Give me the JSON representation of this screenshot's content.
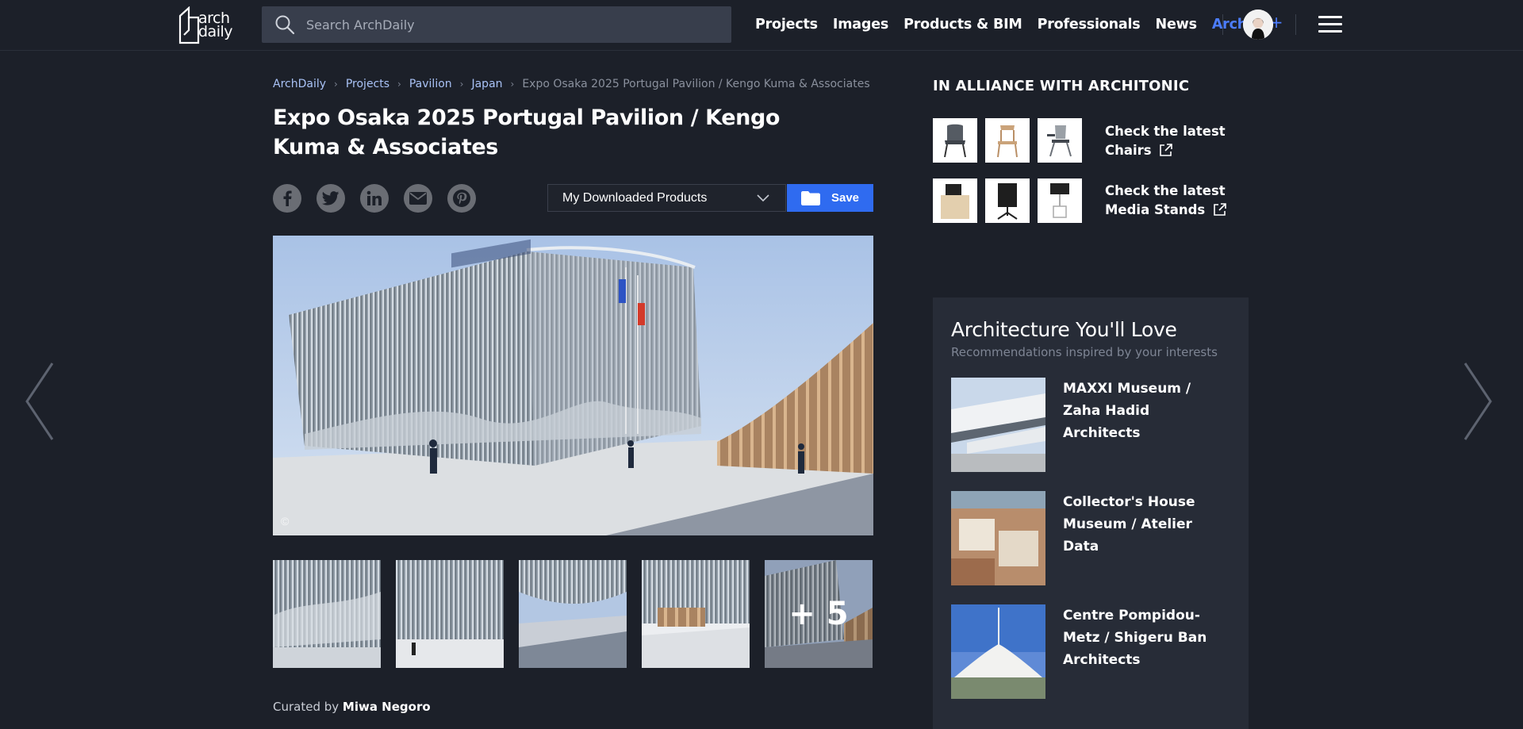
{
  "header": {
    "logo_text": "arch\ndaily",
    "search_placeholder": "Search ArchDaily",
    "nav": [
      "Projects",
      "Images",
      "Products & BIM",
      "Professionals",
      "News"
    ],
    "archive_label": "Archive",
    "archive_suffix": "+"
  },
  "breadcrumb": {
    "items": [
      "ArchDaily",
      "Projects",
      "Pavilion",
      "Japan"
    ],
    "current": "Expo Osaka 2025 Portugal Pavilion / Kengo Kuma & Associates"
  },
  "article": {
    "title": "Expo Osaka 2025 Portugal Pavilion / Kengo Kuma & Associates",
    "dropdown_value": "My Downloaded Products",
    "save_label": "Save",
    "hero_copyright": "©",
    "more_images": "+ 5",
    "curated_prefix": "Curated by ",
    "curator": "Miwa Negoro"
  },
  "social": [
    "facebook-icon",
    "twitter-icon",
    "linkedin-icon",
    "mail-icon",
    "pinterest-icon"
  ],
  "alliance": {
    "title": "IN ALLIANCE WITH ARCHITONIC",
    "chairs_link": "Check the latest Chairs",
    "stands_link": "Check the latest Media Stands"
  },
  "recommendations": {
    "title": "Architecture You'll Love",
    "subtitle": "Recommendations inspired by your interests",
    "items": [
      "MAXXI Museum / Zaha Hadid Architects",
      "Collector's House Museum / Atelier Data",
      "Centre Pompidou-Metz / Shigeru Ban Architects"
    ]
  },
  "colors": {
    "background": "#1c2029",
    "accent": "#2f6bf0",
    "archive": "#4c7dff",
    "breadcrumb_link": "#a9c2f6"
  }
}
